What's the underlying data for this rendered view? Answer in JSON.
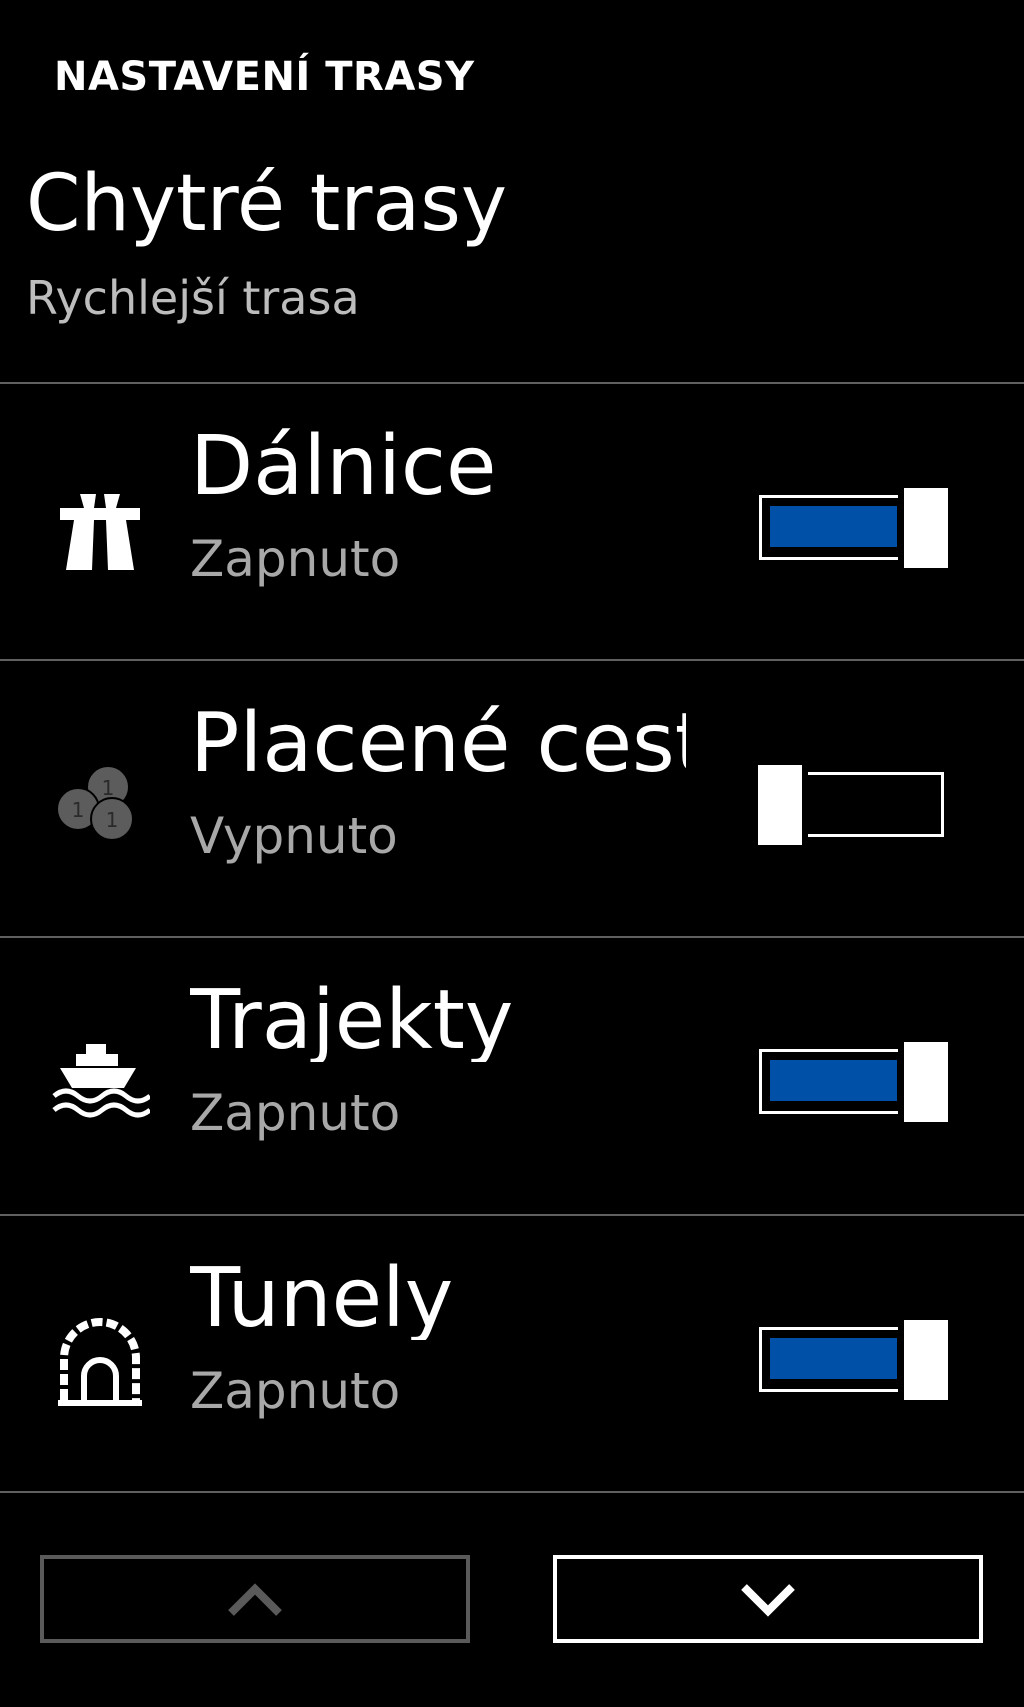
{
  "header": {
    "title": "NASTAVENÍ TRASY"
  },
  "smart_routes": {
    "title": "Chytré trasy",
    "value": "Rychlejší trasa"
  },
  "options": [
    {
      "id": "dalnice",
      "icon": "highway-icon",
      "label": "Dálnice",
      "status": "Zapnuto",
      "on": true
    },
    {
      "id": "placene-cesty",
      "icon": "toll-coins-icon",
      "label": "Placené cesty",
      "status": "Vypnuto",
      "on": false
    },
    {
      "id": "trajekty",
      "icon": "ferry-icon",
      "label": "Trajekty",
      "status": "Zapnuto",
      "on": true
    },
    {
      "id": "tunely",
      "icon": "tunnel-icon",
      "label": "Tunely",
      "status": "Zapnuto",
      "on": true
    }
  ],
  "nav": {
    "up_icon": "chevron-up-icon",
    "down_icon": "chevron-down-icon",
    "up_enabled": false,
    "down_enabled": true
  },
  "colors": {
    "background": "#000000",
    "accent": "#0050a8",
    "secondary_text": "#a8a8a8",
    "divider": "#606060"
  }
}
